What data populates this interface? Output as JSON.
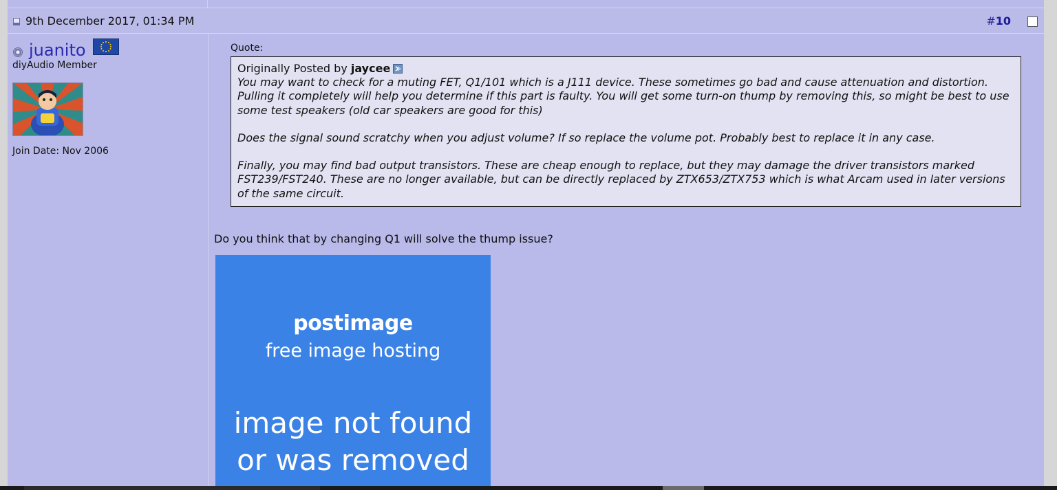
{
  "post": {
    "date": "9th December 2017, 01:34 PM",
    "number_hash": "#",
    "number": "10"
  },
  "user": {
    "name": "juanito",
    "title": "diyAudio Member",
    "join_date": "Join Date: Nov 2006",
    "flag": "eu-flag-icon",
    "avatar": "cartoon-superhero-avatar"
  },
  "quote": {
    "label": "Quote:",
    "originally_posted_by": "Originally Posted by",
    "author": "jaycee",
    "paragraphs": [
      "You may want to check for a muting FET, Q1/101 which is a J111 device. These sometimes go bad and cause attenuation and distortion. Pulling it completely will help you determine if this part is faulty. You will get some turn-on thump by removing this, so might be best to use some test speakers (old car speakers are good for this)",
      "Does the signal sound scratchy when you adjust volume? If so replace the volume pot. Probably best to replace it in any case.",
      "Finally, you may find bad output transistors. These are cheap enough to replace, but they may damage the driver transistors marked FST239/FST240. These are no longer available, but can be directly replaced by ZTX653/ZTX753 which is what Arcam used in later versions of the same circuit."
    ]
  },
  "reply": "Do you think that by changing Q1 will solve the thump issue?",
  "image": {
    "brand": "postimage",
    "tagline": "free image hosting",
    "message_line1": "image not found",
    "message_line2": "or was removed",
    "background": "#3b82e6"
  },
  "colors": {
    "post_bg": "#b9b9ea",
    "quote_bg": "#e2e2f2",
    "username": "#2a2ab0",
    "post_number": "#1c1c9a"
  }
}
